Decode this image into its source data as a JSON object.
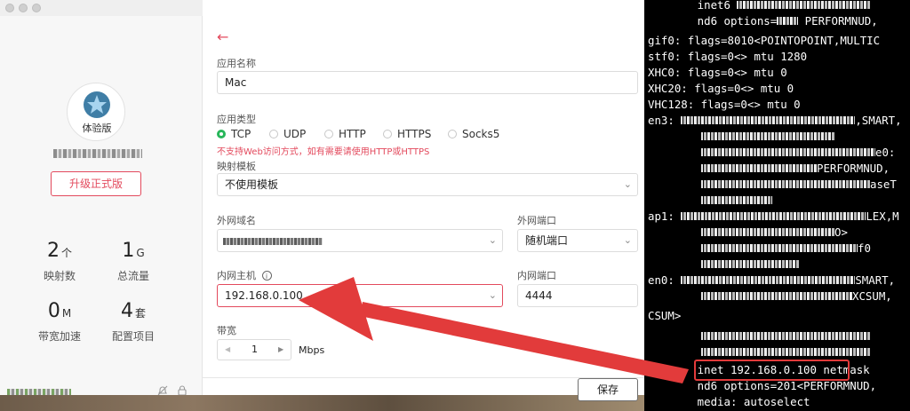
{
  "sidebar": {
    "badge_label": "体验版",
    "upgrade_label": "升级正式版",
    "stats": [
      {
        "value": "2",
        "unit": "个",
        "label": "映射数"
      },
      {
        "value": "1",
        "unit": "G",
        "label": "总流量"
      },
      {
        "value": "0",
        "unit": "M",
        "label": "带宽加速"
      },
      {
        "value": "4",
        "unit": "套",
        "label": "配置项目"
      }
    ]
  },
  "form": {
    "back": "←",
    "app_name_label": "应用名称",
    "app_name_value": "Mac",
    "app_type_label": "应用类型",
    "app_types": [
      "TCP",
      "UDP",
      "HTTP",
      "HTTPS",
      "Socks5"
    ],
    "warning": "不支持Web访问方式，如有需要请使用HTTP或HTTPS",
    "template_label": "映射模板",
    "template_value": "不使用模板",
    "ext_domain_label": "外网域名",
    "ext_port_label": "外网端口",
    "ext_port_value": "随机端口",
    "int_host_label": "内网主机",
    "info_glyph": "i",
    "int_host_value": "192.168.0.100",
    "int_port_label": "内网端口",
    "int_port_value": "4444",
    "bandwidth_label": "带宽",
    "bandwidth_value": "1",
    "bandwidth_unit": "Mbps",
    "step_left": "◀",
    "step_right": "▶",
    "save_label": "保存"
  },
  "terminal": {
    "lines": [
      "        inet6",
      "        nd6 options=",
      "gif0: flags=8010<POINTOPOINT,MULTIC",
      "stf0: flags=0<> mtu 1280",
      "XHC0: flags=0<> mtu 0",
      "XHC20: flags=0<> mtu 0",
      "VHC128: flags=0<> mtu 0",
      "en3:",
      "ap1:",
      "en0:",
      "CSUM>",
      "        inet 192.168.0.100 netmask",
      "        nd6 options=201<PERFORMNUD,",
      "        media: autoselect"
    ],
    "fragments": [
      "PERFORMNUD,",
      ",SMART,",
      "e0:",
      "PERFORMNUD,",
      "aseT",
      "LEX,M",
      "O>",
      "f0",
      "SMART,",
      "XCSUM,"
    ]
  },
  "colors": {
    "accent": "#e34a5d",
    "radio_selected": "#27b65a",
    "highlight": "#e23b3b"
  }
}
